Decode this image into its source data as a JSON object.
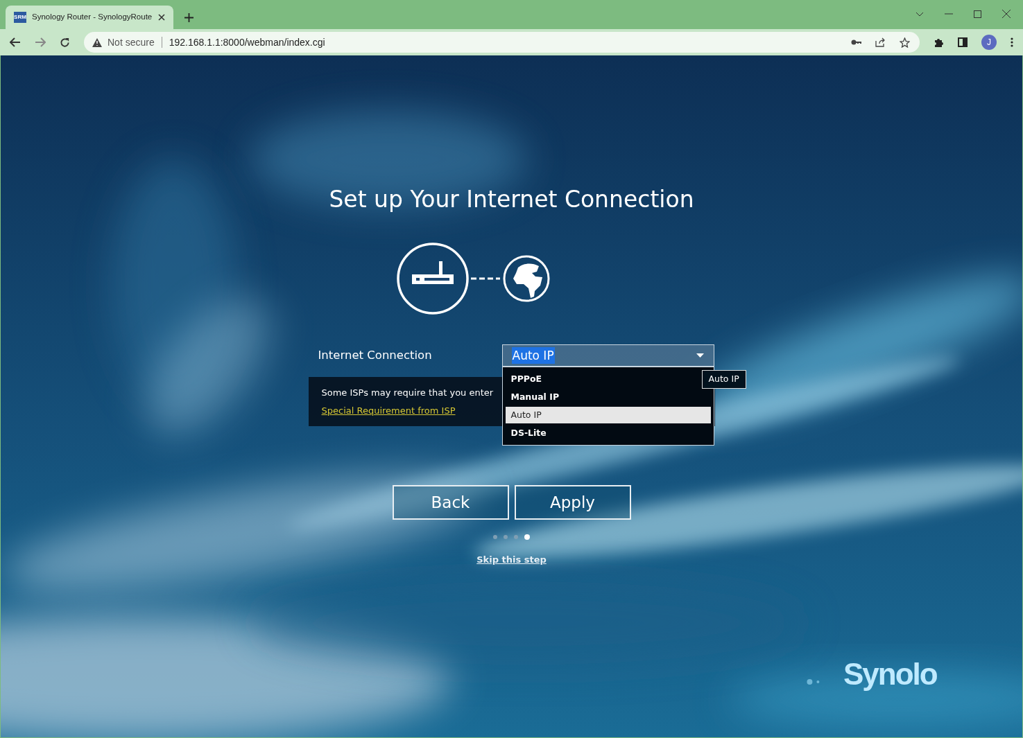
{
  "browser": {
    "tab": {
      "favicon": "SRM",
      "title": "Synology Router - SynologyRoute"
    },
    "address": {
      "security": "Not secure",
      "url": "192.168.1.1:8000/webman/index.cgi"
    },
    "profile": "J"
  },
  "page": {
    "title": "Set up Your Internet Connection",
    "connection": {
      "label": "Internet Connection",
      "value": "Auto IP",
      "tooltip": "Auto IP",
      "expanded": true,
      "options": [
        {
          "label": "PPPoE",
          "selected": false
        },
        {
          "label": "Manual IP",
          "selected": false
        },
        {
          "label": "Auto IP",
          "selected": true
        },
        {
          "label": "DS-Lite",
          "selected": false
        }
      ]
    },
    "notice": {
      "text": "Some ISPs may require that you enter",
      "link": "Special Requirement from ISP"
    },
    "buttons": [
      {
        "label": "Back"
      },
      {
        "label": "Apply"
      }
    ],
    "steps": [
      {
        "selected": false
      },
      {
        "selected": false
      },
      {
        "selected": false
      },
      {
        "selected": true
      }
    ],
    "skip": "Skip this step",
    "logo": "Synolo"
  }
}
